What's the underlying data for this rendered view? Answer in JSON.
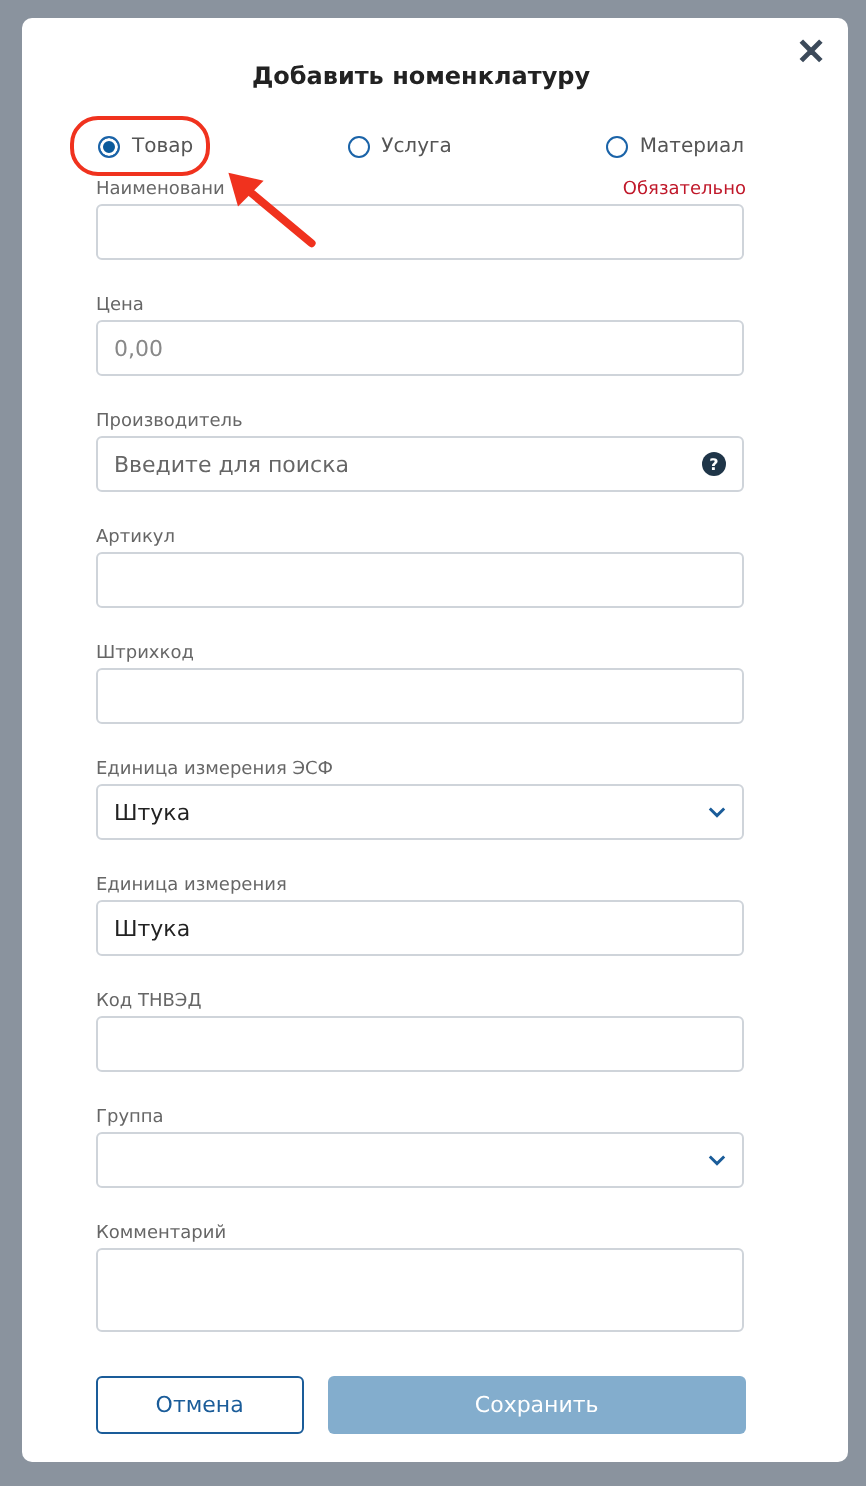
{
  "dialog": {
    "title": "Добавить номенклатуру",
    "close": "✕",
    "types": [
      {
        "label": "Товар",
        "selected": true
      },
      {
        "label": "Услуга",
        "selected": false
      },
      {
        "label": "Материал",
        "selected": false
      }
    ],
    "highlight_selected": true,
    "fields": [
      {
        "kind": "text",
        "label": "Наименовани",
        "required": "Обязательно"
      },
      {
        "kind": "text",
        "label": "Цена",
        "placeholder": "0,00"
      },
      {
        "kind": "search",
        "label": "Производитель",
        "placeholder": "Введите для поиска",
        "help": "?"
      },
      {
        "kind": "text",
        "label": "Артикул"
      },
      {
        "kind": "text",
        "label": "Штрихкод"
      },
      {
        "kind": "select",
        "label": "Единица измерения ЭСФ",
        "value": "Штука"
      },
      {
        "kind": "text",
        "label": "Единица измерения",
        "value": "Штука"
      },
      {
        "kind": "text",
        "label": "Код ТНВЭД"
      },
      {
        "kind": "select",
        "label": "Группа"
      },
      {
        "kind": "textarea",
        "label": "Комментарий"
      }
    ],
    "buttons": [
      {
        "kind": "secondary",
        "label": "Отмена",
        "disabled": false
      },
      {
        "kind": "primary",
        "label": "Сохранить",
        "disabled": true
      }
    ]
  }
}
